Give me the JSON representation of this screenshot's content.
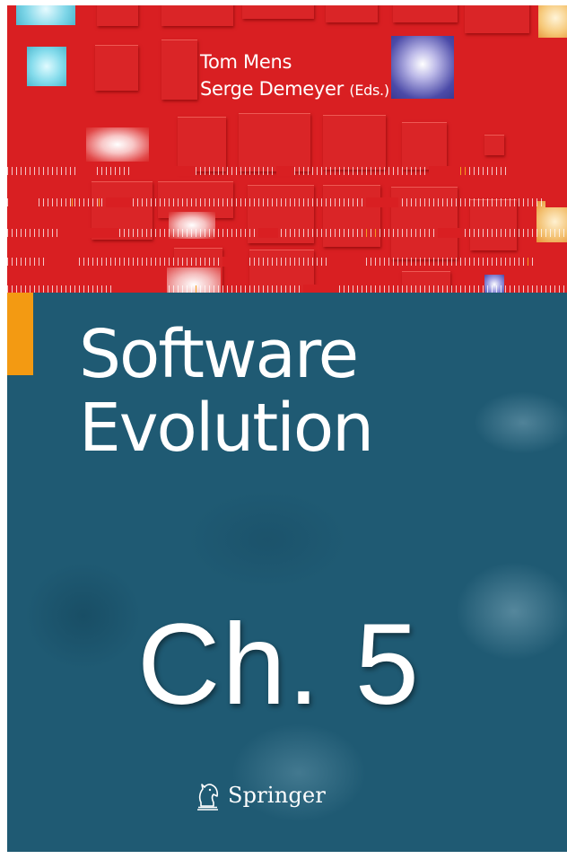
{
  "cover": {
    "authors": [
      "Tom Mens",
      "Serge Demeyer"
    ],
    "editor_suffix": "(Eds.)",
    "title_line1": "Software",
    "title_line2": "Evolution",
    "chapter_label": "Ch. 5",
    "publisher": "Springer",
    "publisher_logo_icon": "springer-chess-knight-icon",
    "colors": {
      "top_band": "#d91f22",
      "bottom_band": "#1f5a73",
      "accent_bar": "#f39a12",
      "text": "#ffffff"
    }
  }
}
